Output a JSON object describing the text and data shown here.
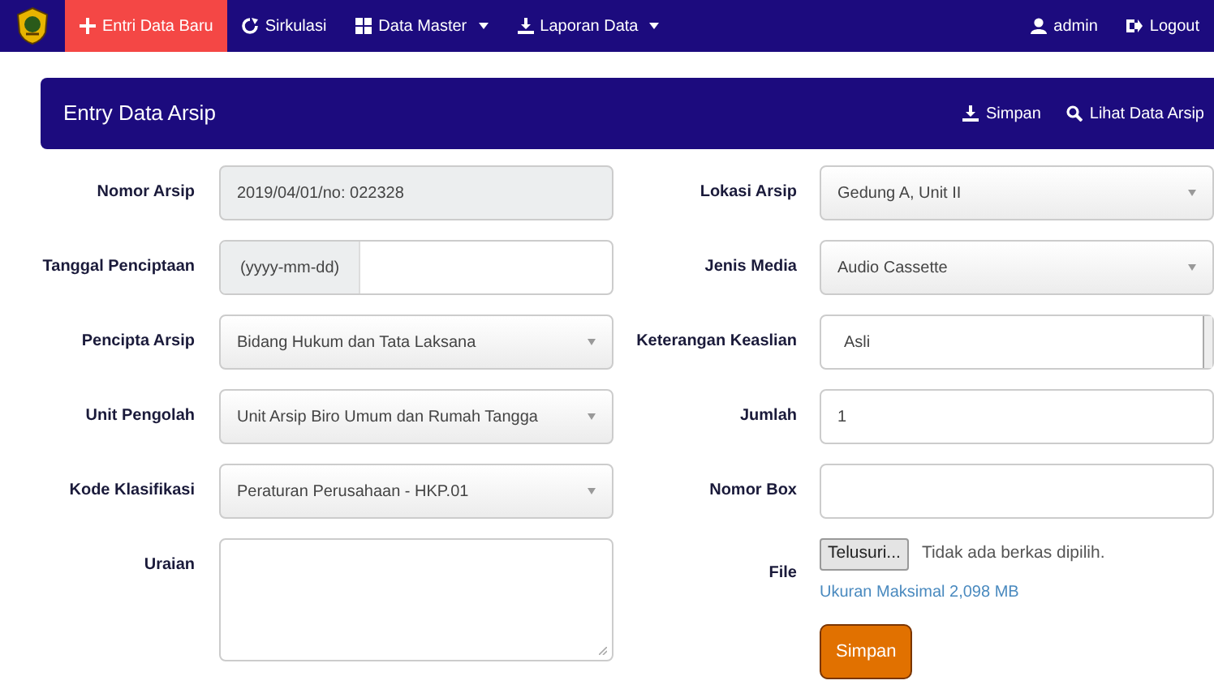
{
  "navbar": {
    "items": [
      {
        "label": "Entri Data Baru",
        "selected": true,
        "dropdown": false
      },
      {
        "label": "Sirkulasi",
        "selected": false,
        "dropdown": false
      },
      {
        "label": "Data Master",
        "selected": false,
        "dropdown": true
      },
      {
        "label": "Laporan Data",
        "selected": false,
        "dropdown": true
      }
    ],
    "right_items": [
      {
        "label": "admin"
      },
      {
        "label": "Logout"
      }
    ]
  },
  "panel": {
    "title": "Entry Data Arsip",
    "actions": [
      {
        "label": "Simpan"
      },
      {
        "label": "Lihat Data Arsip"
      }
    ]
  },
  "left_fields": [
    {
      "label": "Nomor Arsip",
      "kind": "readonly",
      "value": "2019/04/01/no: 022328"
    },
    {
      "label": "Tanggal Penciptaan",
      "kind": "addon",
      "addon": "(yyyy-mm-dd)"
    },
    {
      "label": "Pencipta Arsip",
      "kind": "select",
      "value": "Bidang Hukum dan Tata Laksana"
    },
    {
      "label": "Unit Pengolah",
      "kind": "select",
      "value": "Unit Arsip Biro Umum dan Rumah Tangga"
    },
    {
      "label": "Kode Klasifikasi",
      "kind": "select",
      "value": "Peraturan Perusahaan - HKP.01"
    },
    {
      "label": "Uraian",
      "kind": "textarea"
    }
  ],
  "right_fields": [
    {
      "label": "Lokasi Arsip",
      "kind": "select",
      "value": "Gedung A, Unit II"
    },
    {
      "label": "Jenis Media",
      "kind": "select",
      "value": "Audio Cassette"
    },
    {
      "label": "Keterangan Keaslian",
      "kind": "native",
      "value": "Asli"
    },
    {
      "label": "Jumlah",
      "kind": "input",
      "value": "1"
    },
    {
      "label": "Nomor Box",
      "kind": "input"
    },
    {
      "label": "File",
      "kind": "file",
      "button": "Telusuri...",
      "status": "Tidak ada berkas dipilih.",
      "help": "Ukuran Maksimal 2,098 MB"
    }
  ],
  "submit": {
    "label": "Simpan"
  }
}
